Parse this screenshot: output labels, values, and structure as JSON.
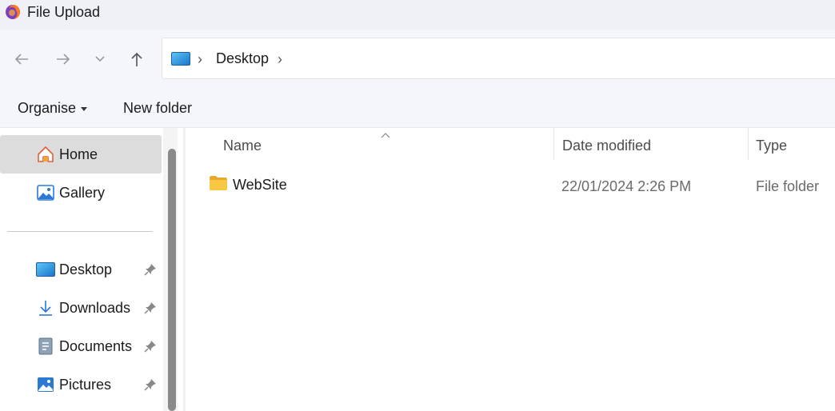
{
  "window": {
    "title": "File Upload"
  },
  "nav": {
    "back_icon": "arrow-left-icon",
    "forward_icon": "arrow-right-icon",
    "recent_icon": "chevron-down-icon",
    "up_icon": "arrow-up-icon"
  },
  "address": {
    "separator": "›",
    "location": "Desktop",
    "trailing_separator": "›"
  },
  "toolbar": {
    "organise_label": "Organise",
    "new_folder_label": "New folder"
  },
  "sidebar": {
    "items": [
      {
        "label": "Home",
        "icon": "home-icon",
        "selected": true
      },
      {
        "label": "Gallery",
        "icon": "gallery-icon"
      },
      {
        "label": "Desktop",
        "icon": "desktop-icon",
        "pinned": true
      },
      {
        "label": "Downloads",
        "icon": "download-icon",
        "pinned": true
      },
      {
        "label": "Documents",
        "icon": "documents-icon",
        "pinned": true
      },
      {
        "label": "Pictures",
        "icon": "pictures-icon",
        "pinned": true
      }
    ]
  },
  "columns": {
    "name": "Name",
    "date": "Date modified",
    "type": "Type"
  },
  "rows": [
    {
      "name": "WebSite",
      "date": "22/01/2024 2:26 PM",
      "type": "File folder"
    }
  ],
  "colors": {
    "selection": "#dcdcdc",
    "folder": "#f8c845",
    "accent": "#2a7ad5"
  }
}
